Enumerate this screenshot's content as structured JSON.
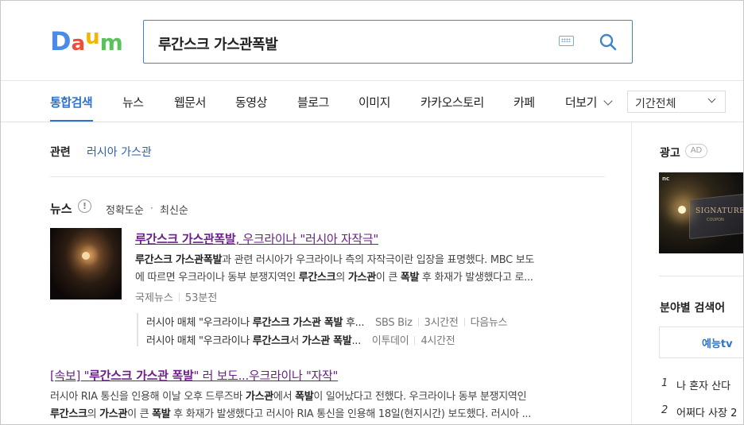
{
  "header": {
    "logo_letters": [
      {
        "ch": "D",
        "color": "#4a8ae8"
      },
      {
        "ch": "a",
        "color": "#ef4e3d"
      },
      {
        "ch": "u",
        "color": "#f7b500"
      },
      {
        "ch": "m",
        "color": "#5ac25b"
      }
    ],
    "search_query": "루간스크 가스관폭발",
    "icons": [
      "keyboard-icon",
      "search-icon"
    ]
  },
  "tabs": [
    {
      "label": "통합검색",
      "active": true
    },
    {
      "label": "뉴스"
    },
    {
      "label": "웹문서"
    },
    {
      "label": "동영상"
    },
    {
      "label": "블로그"
    },
    {
      "label": "이미지"
    },
    {
      "label": "카카오스토리"
    },
    {
      "label": "카페"
    },
    {
      "label": "더보기"
    }
  ],
  "period_select": {
    "value": "기간전체"
  },
  "related": {
    "label": "관련",
    "links": [
      "러시아 가스관"
    ]
  },
  "news": {
    "section_title": "뉴스",
    "sort_options": [
      "정확도순",
      "최신순"
    ],
    "sort_separator": "·",
    "article1": {
      "title_parts": [
        "루간스크 가스관폭발",
        ", 우크라이나 \"러시아 자작극\""
      ],
      "desc_line1": [
        "루간스크 가스관폭발",
        "과 관련 러시아가 우크라이나 측의 자작극이란 입장을 표명했다. MBC 보도"
      ],
      "desc_line2": [
        "에 따르면 우크라이나 동부 분쟁지역인 ",
        "루간스크",
        "의 ",
        "가스관",
        "이 큰 ",
        "폭발",
        " 후 화재가 발생했다고 로..."
      ],
      "source": "국제뉴스",
      "time": "53분전"
    },
    "sub_articles": [
      {
        "pre": "러시아 매체 \"우크라이나 ",
        "bold1": "루간스크 가스관 폭발",
        "post": " 후...",
        "source": "SBS Biz",
        "time": "3시간전",
        "extra": "다음뉴스"
      },
      {
        "pre": "러시아 매체 \"우크라이나 ",
        "bold1": "루간스크",
        "mid": "서 ",
        "bold2": "가스관 폭발",
        "post": "...",
        "source": "이투데이",
        "time": "4시간전"
      }
    ],
    "article2": {
      "title_parts": [
        "[속보] \"",
        "루간스크 가스관 폭발",
        "\" 러 보도...우크라이나 \"자작\""
      ],
      "desc_line1": [
        "러시아 RIA 통신을 인용해 이날 오후 드루즈바 ",
        "가스관",
        "에서 ",
        "폭발",
        "이 일어났다고 전했다. 우크라이나 동부 분쟁지역인"
      ],
      "desc_line2": [
        "루간스크",
        "의 ",
        "가스관",
        "이 큰 ",
        "폭발",
        " 후 화재가 발생했다고 러시아 RIA 통신을 인용해 18일(현지시간) 보도했다. 러시아 ..."
      ]
    }
  },
  "sidebar": {
    "ad_title": "광고",
    "ad_badge": "AD",
    "ad_image_text": {
      "brand": "nc",
      "main": "SIGNATURE",
      "sub": "COUPON"
    },
    "category_title": "분야별 검색어",
    "category_tab": "예능tv",
    "ranks": [
      {
        "num": "1",
        "text": "나 혼자 산다"
      },
      {
        "num": "2",
        "text": "어쩌다 사장 2"
      }
    ]
  }
}
